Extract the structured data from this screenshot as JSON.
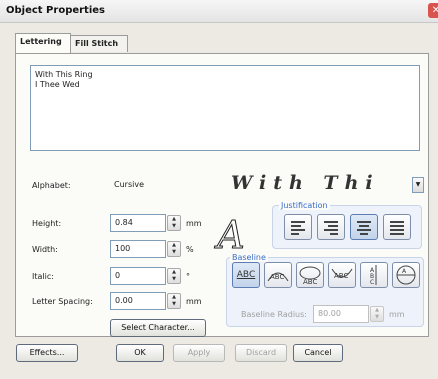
{
  "window": {
    "title": "Object Properties",
    "close_glyph": "✕"
  },
  "tabs": [
    {
      "label": "Lettering"
    },
    {
      "label": "Fill Stitch"
    }
  ],
  "text_content": {
    "lines": [
      "With This Ring",
      "I Thee Wed"
    ]
  },
  "alphabet": {
    "label": "Alphabet:",
    "value": "Cursive",
    "preview": "With Thi"
  },
  "height": {
    "label": "Height:",
    "value": "0.84",
    "unit": "mm"
  },
  "width": {
    "label": "Width:",
    "value": "100",
    "unit": "%"
  },
  "italic": {
    "label": "Italic:",
    "value": "0",
    "unit": "°"
  },
  "letter_spacing": {
    "label": "Letter Spacing:",
    "value": "0.00",
    "unit": "mm"
  },
  "select_character": {
    "label": "Select Character..."
  },
  "justification": {
    "title": "Justification",
    "options": [
      "left",
      "right",
      "center",
      "full"
    ],
    "selected": "center"
  },
  "baseline": {
    "title": "Baseline",
    "options": [
      "straight",
      "arc-up",
      "circle",
      "arc-down",
      "vertical",
      "circle-full"
    ],
    "selected": "straight",
    "radius_label": "Baseline Radius:",
    "radius_value": "80.00",
    "radius_unit": "mm"
  },
  "footer": {
    "effects": "Effects...",
    "ok": "OK",
    "apply": "Apply",
    "discard": "Discard",
    "cancel": "Cancel"
  }
}
